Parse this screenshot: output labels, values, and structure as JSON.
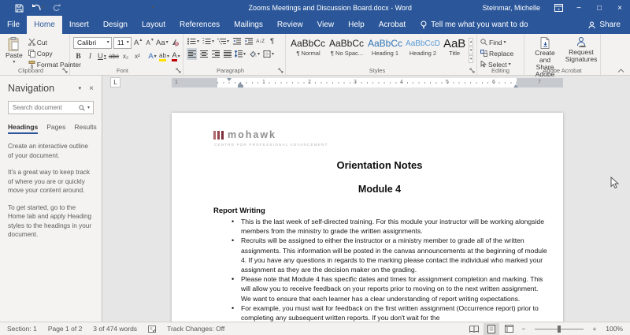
{
  "icons": {
    "minimize": "−",
    "maximize": "□",
    "close": "×",
    "caret": "▾",
    "caret_up": "▴",
    "pilcrow": "¶",
    "tab_stop": "L",
    "sort": "A↓Z",
    "spacing": "↕"
  },
  "titlebar": {
    "title": "Zooms Meetings and Discussion Board.docx - Word",
    "user": "Steinmar, Michelle"
  },
  "tabs": {
    "file": "File",
    "items": [
      "Home",
      "Insert",
      "Design",
      "Layout",
      "References",
      "Mailings",
      "Review",
      "View",
      "Help",
      "Acrobat"
    ],
    "tell_me": "Tell me what you want to do",
    "share": "Share"
  },
  "ribbon": {
    "clipboard": {
      "label": "Clipboard",
      "paste": "Paste",
      "cut": "Cut",
      "copy": "Copy",
      "format_painter": "Format Painter"
    },
    "font": {
      "label": "Font",
      "name": "Calibri",
      "size": "11",
      "grow": "A",
      "shrink": "A",
      "change_case": "Aa",
      "bold": "B",
      "italic": "I",
      "underline": "U",
      "strike": "abc",
      "subscript": "x₂",
      "superscript": "x²",
      "effects": "A",
      "highlight": "ab",
      "color": "A"
    },
    "paragraph": {
      "label": "Paragraph"
    },
    "styles": {
      "label": "Styles",
      "items": [
        {
          "sample": "AaBbCcI",
          "name": "¶ Normal"
        },
        {
          "sample": "AaBbCcI",
          "name": "¶ No Spac..."
        },
        {
          "sample": "AaBbCc",
          "name": "Heading 1"
        },
        {
          "sample": "AaBbCcD",
          "name": "Heading 2"
        },
        {
          "sample": "AaB",
          "name": "Title"
        }
      ]
    },
    "editing": {
      "label": "Editing",
      "find": "Find",
      "replace": "Replace",
      "select": "Select"
    },
    "acrobat": {
      "label": "Adobe Acrobat",
      "create_pdf": "Create and Share Adobe PDF",
      "request_signatures": "Request Signatures"
    }
  },
  "nav": {
    "title": "Navigation",
    "search_placeholder": "Search document",
    "tabs": [
      "Headings",
      "Pages",
      "Results"
    ],
    "help": [
      "Create an interactive outline of your document.",
      "It's a great way to keep track of where you are or quickly move your content around.",
      "To get started, go to the Home tab and apply Heading styles to the headings in your document."
    ]
  },
  "ruler": {
    "margin_left_num": "1",
    "numbers": [
      "1",
      "2",
      "3",
      "4",
      "5",
      "6"
    ],
    "margin_right_num": "7"
  },
  "doc": {
    "brand": "mohawk",
    "tagline": "CENTRE FOR PROFESSIONAL ADVANCEMENT",
    "title": "Orientation Notes",
    "subtitle": "Module 4",
    "heading": "Report Writing",
    "bullets": [
      "This is the last week of self-directed training. For this module your instructor will be working alongside members from the ministry to grade the written assignments.",
      "Recruits will be assigned to either the instructor or a ministry member to grade all of the written assignments. This information will be posted in the canvas announcements at the beginning of module 4. If you have any questions in regards to the marking please contact the individual who marked your assignment as they are the decision maker on the grading.",
      "Please note that Module 4 has specific dates and times for assignment completion and marking.  This will allow you to receive feedback on your reports prior to moving on to the next written assignment.  We want to ensure that each learner has a clear understanding of report writing expectations.",
      "For example, you must wait for feedback on the first written assignment (Occurrence report) prior to completing any subsequent written reports. If you don't wait for the"
    ]
  },
  "status": {
    "section": "Section: 1",
    "page": "Page 1 of 2",
    "words": "3 of 474 words",
    "track": "Track Changes: Off",
    "zoom_out": "−",
    "zoom_in": "+",
    "zoom_level": "100%"
  },
  "colors": {
    "accent": "#2b579a",
    "heading_blue": "#2e74b5",
    "logo_maroon": "#94424c",
    "highlight_yellow": "#ffe100",
    "font_color_red": "#c00000"
  }
}
